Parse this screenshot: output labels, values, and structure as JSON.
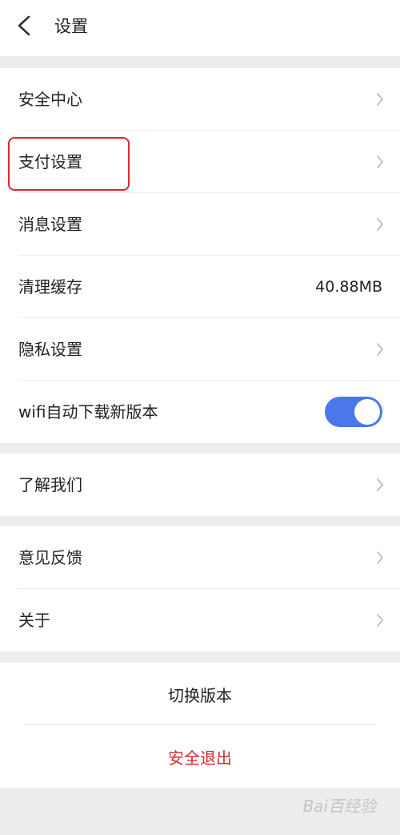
{
  "header": {
    "title": "设置",
    "back_icon": "chevron-left-icon"
  },
  "group1": {
    "items": [
      {
        "label": "安全中心"
      },
      {
        "label": "支付设置"
      },
      {
        "label": "消息设置"
      },
      {
        "label": "清理缓存",
        "value": "40.88MB"
      },
      {
        "label": "隐私设置"
      },
      {
        "label": "wifi自动下载新版本",
        "toggle_on": true
      }
    ]
  },
  "group2": {
    "items": [
      {
        "label": "了解我们"
      }
    ]
  },
  "group3": {
    "items": [
      {
        "label": "意见反馈"
      },
      {
        "label": "关于"
      }
    ]
  },
  "actions": {
    "switch_version": "切换版本",
    "logout": "安全退出"
  },
  "watermark": "Bai百经验",
  "colors": {
    "accent": "#4a78ea",
    "danger": "#d7262c",
    "highlight": "#d8282f",
    "background": "#ededed"
  }
}
